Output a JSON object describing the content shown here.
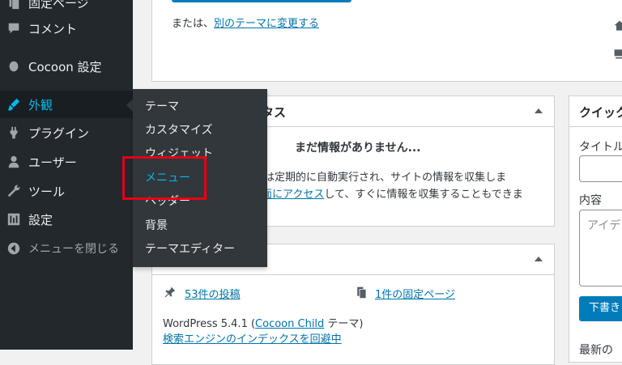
{
  "sidebar": {
    "items": [
      {
        "label": "固定ページ",
        "icon": "pages-icon"
      },
      {
        "label": "コメント",
        "icon": "comments-icon"
      },
      {
        "label": "Cocoon 設定",
        "icon": "cocoon-icon"
      },
      {
        "label": "外観",
        "icon": "brush-icon"
      },
      {
        "label": "プラグイン",
        "icon": "plugins-icon"
      },
      {
        "label": "ユーザー",
        "icon": "user-icon"
      },
      {
        "label": "ツール",
        "icon": "wrench-icon"
      },
      {
        "label": "設定",
        "icon": "settings-icon"
      },
      {
        "label": "メニューを閉じる",
        "icon": "collapse-icon"
      }
    ]
  },
  "flyout": {
    "items": [
      "テーマ",
      "カスタマイズ",
      "ウィジェット",
      "メニュー",
      "ヘッダー",
      "背景",
      "テーマエディター"
    ]
  },
  "top_panel": {
    "prefix": "または、",
    "link": "別のテーマに変更する"
  },
  "status_panel": {
    "title_tail": "タス",
    "heading": "まだ情報がありません...",
    "line1": "マは定期的に自動実行され、サイトの情報を収集しま",
    "line2_link": "面にアクセス",
    "line2_rest": "して、すぐに情報を収集することもできま"
  },
  "glance_panel": {
    "posts": "53件の投稿",
    "pages": "1件の固定ページ",
    "wp_version_prefix": "WordPress 5.4.1 (",
    "theme_link": "Cocoon Child",
    "wp_version_suffix": " テーマ)",
    "search_link": "検索エンジンのインデックスを回避中"
  },
  "quick_panel": {
    "title": "クイック",
    "title_label": "タイトル",
    "content_label": "内容",
    "content_placeholder": "アイデ",
    "save_button": "下書き",
    "recent_label": "最新の"
  }
}
